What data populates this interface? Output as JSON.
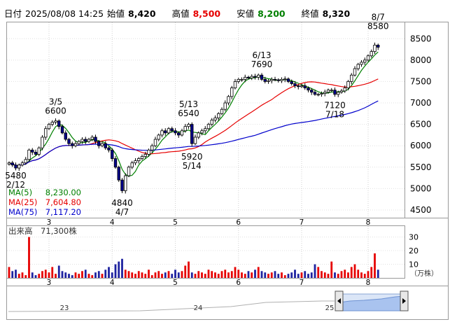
{
  "header": {
    "date_label": "日付",
    "datetime": "2025/08/08 14:25",
    "open_label": "始値",
    "open": "8,420",
    "high_label": "高値",
    "high": "8,500",
    "low_label": "安値",
    "low": "8,200",
    "close_label": "終値",
    "close": "8,320",
    "colors": {
      "high": "#e60000",
      "low": "#008000",
      "text": "#000000"
    }
  },
  "legend": {
    "ma5_label": "MA(5)",
    "ma5_value": "8,230.00",
    "ma25_label": "MA(25)",
    "ma25_value": "7,604.80",
    "ma75_label": "MA(75)",
    "ma75_value": "7,117.20",
    "colors": {
      "ma5": "#008000",
      "ma25": "#e60000",
      "ma75": "#0000cc"
    }
  },
  "volume_label": "出来高",
  "volume_value": "71,300株",
  "volume_unit": "（万株）",
  "chart_data": {
    "type": "candlestick",
    "price_axis": {
      "ylim": [
        4320,
        8880
      ],
      "ticks": [
        4500,
        5000,
        5500,
        6000,
        6500,
        7000,
        7500,
        8000,
        8500
      ]
    },
    "month_ticks": [
      {
        "label": "3",
        "index": 12
      },
      {
        "label": "4",
        "index": 31
      },
      {
        "label": "5",
        "index": 50
      },
      {
        "label": "6",
        "index": 69
      },
      {
        "label": "7",
        "index": 88
      },
      {
        "label": "8",
        "index": 108
      }
    ],
    "annotations": [
      {
        "text": "5480",
        "index": 2,
        "value": 5480,
        "pos": "below-top"
      },
      {
        "text": "2/12",
        "index": 2,
        "value": 5480,
        "pos": "below-bottom"
      },
      {
        "text": "3/5",
        "index": 14,
        "value": 6600,
        "pos": "above-top"
      },
      {
        "text": "6600",
        "index": 14,
        "value": 6600,
        "pos": "above-bottom"
      },
      {
        "text": "5/13",
        "index": 54,
        "value": 6540,
        "pos": "above-top"
      },
      {
        "text": "6540",
        "index": 54,
        "value": 6540,
        "pos": "above-bottom"
      },
      {
        "text": "5920",
        "index": 55,
        "value": 5920,
        "pos": "below-top"
      },
      {
        "text": "5/14",
        "index": 55,
        "value": 5920,
        "pos": "below-bottom"
      },
      {
        "text": "4840",
        "index": 34,
        "value": 4840,
        "pos": "below-top"
      },
      {
        "text": "4/7",
        "index": 34,
        "value": 4840,
        "pos": "below-bottom"
      },
      {
        "text": "6/13",
        "index": 76,
        "value": 7690,
        "pos": "above-top"
      },
      {
        "text": "7690",
        "index": 76,
        "value": 7690,
        "pos": "above-bottom"
      },
      {
        "text": "7120",
        "index": 98,
        "value": 7120,
        "pos": "below-top"
      },
      {
        "text": "7/18",
        "index": 98,
        "value": 7120,
        "pos": "below-bottom"
      },
      {
        "text": "8/7",
        "index": 111,
        "value": 8580,
        "pos": "above-top"
      },
      {
        "text": "8580",
        "index": 111,
        "value": 8580,
        "pos": "above-bottom"
      }
    ],
    "closes": [
      5600,
      5550,
      5480,
      5550,
      5600,
      5680,
      5900,
      5850,
      5800,
      5950,
      6200,
      6400,
      6500,
      6550,
      6580,
      6450,
      6300,
      6150,
      6050,
      6000,
      6050,
      6100,
      6150,
      6100,
      6150,
      6200,
      6100,
      6000,
      6050,
      5950,
      5900,
      5700,
      5500,
      5200,
      4950,
      5300,
      5500,
      5600,
      5650,
      5700,
      5750,
      5800,
      5900,
      6000,
      6150,
      6250,
      6350,
      6300,
      6400,
      6350,
      6300,
      6250,
      6350,
      6450,
      6500,
      6050,
      6200,
      6300,
      6350,
      6400,
      6500,
      6600,
      6650,
      6750,
      6850,
      7000,
      7150,
      7350,
      7500,
      7550,
      7550,
      7600,
      7580,
      7620,
      7600,
      7650,
      7550,
      7500,
      7520,
      7550,
      7540,
      7520,
      7550,
      7560,
      7500,
      7450,
      7400,
      7380,
      7400,
      7350,
      7300,
      7250,
      7200,
      7200,
      7220,
      7250,
      7300,
      7300,
      7200,
      7250,
      7280,
      7350,
      7500,
      7650,
      7800,
      7900,
      7950,
      8000,
      8100,
      8200,
      8350,
      8300
    ],
    "volume": {
      "ylim": [
        0,
        38
      ],
      "ticks": [
        10,
        20,
        30
      ],
      "values": [
        8,
        5,
        6,
        3,
        4,
        2,
        30,
        4,
        2,
        3,
        5,
        6,
        4,
        8,
        3,
        9,
        5,
        4,
        3,
        2,
        4,
        3,
        5,
        6,
        3,
        2,
        4,
        5,
        3,
        6,
        8,
        4,
        10,
        12,
        14,
        6,
        5,
        4,
        3,
        5,
        4,
        3,
        6,
        2,
        4,
        5,
        3,
        4,
        5,
        3,
        6,
        4,
        5,
        9,
        12,
        4,
        3,
        5,
        4,
        3,
        6,
        5,
        4,
        3,
        5,
        6,
        4,
        5,
        8,
        6,
        4,
        3,
        5,
        4,
        6,
        8,
        5,
        4,
        3,
        4,
        5,
        3,
        4,
        2,
        3,
        4,
        6,
        3,
        4,
        5,
        3,
        4,
        10,
        8,
        5,
        4,
        3,
        12,
        4,
        3,
        5,
        6,
        4,
        8,
        10,
        6,
        4,
        3,
        5,
        8,
        18,
        6
      ]
    },
    "navigator": {
      "labels": [
        "23",
        "24",
        "25"
      ]
    }
  }
}
